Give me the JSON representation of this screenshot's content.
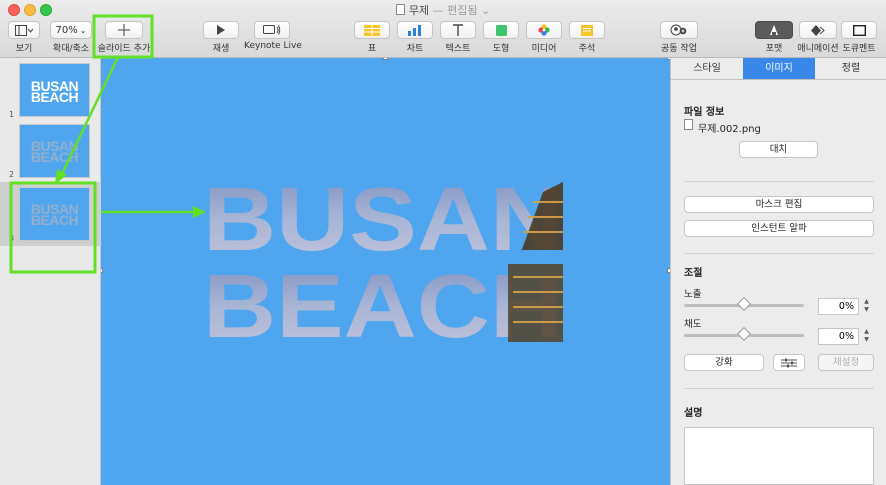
{
  "window": {
    "title": "무제",
    "separator": " — ",
    "status": "편집됨",
    "chevron": "⌄"
  },
  "toolbar": {
    "view": {
      "label": "보기",
      "icon": "sidebar-layout-icon"
    },
    "zoom": {
      "label": "확대/축소",
      "value": "70%"
    },
    "add_slide": {
      "label": "슬라이드 추가",
      "icon": "plus-icon"
    },
    "play": {
      "label": "재생",
      "icon": "play-icon"
    },
    "keynote_live": {
      "label": "Keynote Live",
      "icon": "keynote-live-icon"
    },
    "table": {
      "label": "표",
      "icon": "table-icon"
    },
    "chart": {
      "label": "차트",
      "icon": "chart-icon"
    },
    "text": {
      "label": "텍스트",
      "icon": "text-icon"
    },
    "shape": {
      "label": "도형",
      "icon": "shape-icon"
    },
    "media": {
      "label": "미디어",
      "icon": "media-icon"
    },
    "comment": {
      "label": "주석",
      "icon": "comment-icon"
    },
    "collaborate": {
      "label": "공동 작업",
      "icon": "collaborate-icon"
    },
    "format": {
      "label": "포맷",
      "icon": "format-brush-icon"
    },
    "animate": {
      "label": "애니메이션",
      "icon": "animate-diamond-icon"
    },
    "document": {
      "label": "도큐멘트",
      "icon": "document-icon"
    }
  },
  "navigator": {
    "slides": [
      {
        "number": "1",
        "line1": "BUSAN",
        "line2": "BEACH"
      },
      {
        "number": "2",
        "line1": "BUSAN",
        "line2": "BEACH"
      },
      {
        "number": "3",
        "line1": "BUSAN",
        "line2": "BEACH"
      }
    ]
  },
  "canvas": {
    "line1": "BUSAN",
    "line2": "BEACH"
  },
  "inspector": {
    "tabs": [
      "스타일",
      "이미지",
      "정렬"
    ],
    "active_tab": "이미지",
    "file_info_title": "파일 정보",
    "file_name": "무제.002.png",
    "replace_button": "대치",
    "edit_mask_button": "마스크 편집",
    "instant_alpha_button": "인스턴트 알파",
    "adjust_title": "조절",
    "exposure_label": "노출",
    "exposure_value": "0%",
    "saturation_label": "채도",
    "saturation_value": "0%",
    "enhance_button": "강화",
    "reset_button": "재설정",
    "description_title": "설명"
  },
  "colors": {
    "slide_bg": "#4fa6ef",
    "accent": "#3a87ea",
    "annotation": "#62e026"
  }
}
